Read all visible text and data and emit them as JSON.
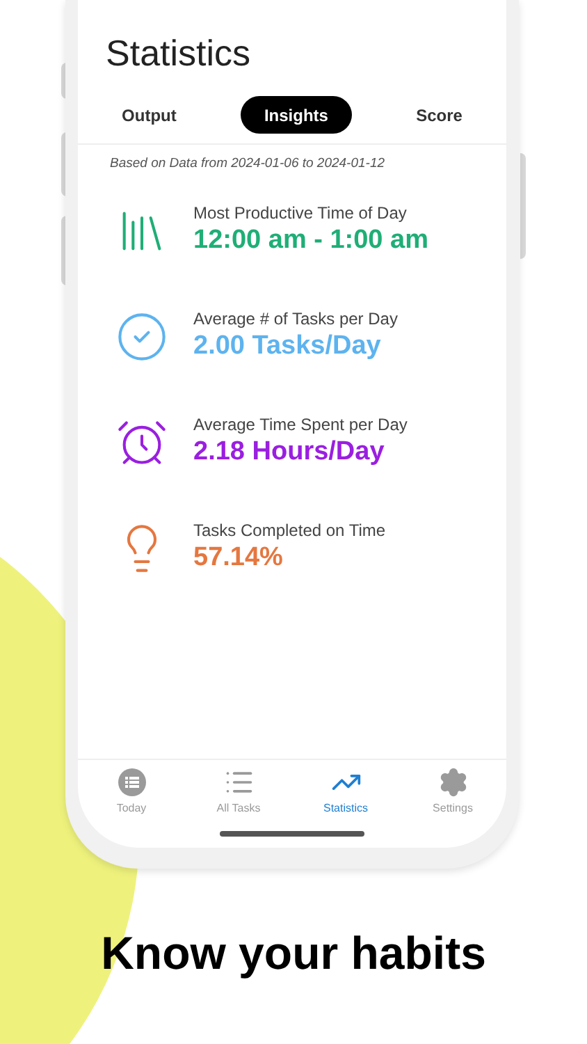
{
  "screen": {
    "title": "Statistics",
    "tabs": [
      {
        "label": "Output",
        "selected": false
      },
      {
        "label": "Insights",
        "selected": true
      },
      {
        "label": "Score",
        "selected": false
      }
    ],
    "note": "Based on Data from 2024-01-06 to 2024-01-12",
    "stats": [
      {
        "kind": "books",
        "label": "Most Productive Time of Day",
        "value": "12:00 am - 1:00 am",
        "color": "#1fae76"
      },
      {
        "kind": "check",
        "label": "Average # of Tasks per Day",
        "value": "2.00 Tasks/Day",
        "color": "#5db3ef"
      },
      {
        "kind": "alarm",
        "label": "Average Time Spent per Day",
        "value": "2.18 Hours/Day",
        "color": "#9a1fe0"
      },
      {
        "kind": "bulb",
        "label": "Tasks Completed on Time",
        "value": "57.14%",
        "color": "#e5773f"
      }
    ],
    "nav": [
      {
        "kind": "today",
        "label": "Today",
        "selected": false
      },
      {
        "kind": "list",
        "label": "All Tasks",
        "selected": false
      },
      {
        "kind": "stats",
        "label": "Statistics",
        "selected": true
      },
      {
        "kind": "settings",
        "label": "Settings",
        "selected": false
      }
    ]
  },
  "caption": "Know your habits"
}
